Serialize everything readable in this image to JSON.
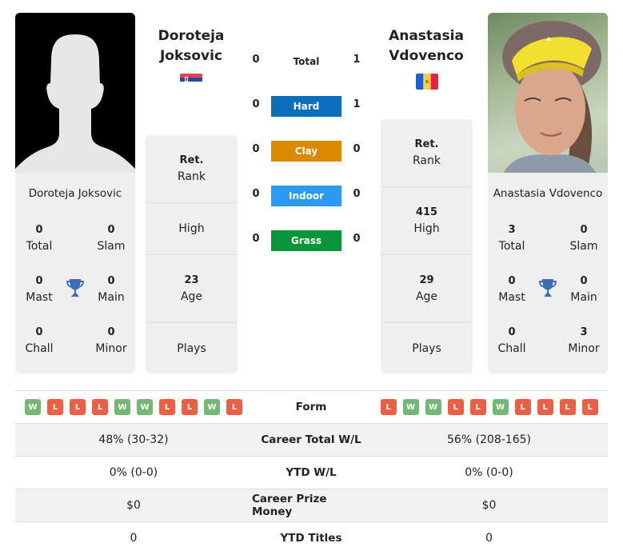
{
  "player1": {
    "name_line1": "Doroteja",
    "name_line2": "Joksovic",
    "full_name": "Doroteja Joksovic",
    "flag": "serbia-flag",
    "photo": "silhouette-placeholder",
    "titles": {
      "total": {
        "value": "0",
        "label": "Total"
      },
      "slam": {
        "value": "0",
        "label": "Slam"
      },
      "mast": {
        "value": "0",
        "label": "Mast"
      },
      "main": {
        "value": "0",
        "label": "Main"
      },
      "chall": {
        "value": "0",
        "label": "Chall"
      },
      "minor": {
        "value": "0",
        "label": "Minor"
      }
    },
    "info": {
      "rank": {
        "value": "Ret.",
        "label": "Rank"
      },
      "high": {
        "value": "",
        "label": "High"
      },
      "age": {
        "value": "23",
        "label": "Age"
      },
      "plays": {
        "value": "",
        "label": "Plays"
      }
    },
    "form": [
      "W",
      "L",
      "L",
      "L",
      "W",
      "W",
      "L",
      "L",
      "W",
      "L"
    ],
    "career_wl": "48% (30-32)",
    "ytd_wl": "0% (0-0)",
    "prize_money": "$0",
    "ytd_titles": "0"
  },
  "player2": {
    "name_line1": "Anastasia",
    "name_line2": "Vdovenco",
    "full_name": "Anastasia Vdovenco",
    "flag": "moldova-flag",
    "photo": "player-photo",
    "titles": {
      "total": {
        "value": "3",
        "label": "Total"
      },
      "slam": {
        "value": "0",
        "label": "Slam"
      },
      "mast": {
        "value": "0",
        "label": "Mast"
      },
      "main": {
        "value": "0",
        "label": "Main"
      },
      "chall": {
        "value": "0",
        "label": "Chall"
      },
      "minor": {
        "value": "3",
        "label": "Minor"
      }
    },
    "info": {
      "rank": {
        "value": "Ret.",
        "label": "Rank"
      },
      "high": {
        "value": "415",
        "label": "High"
      },
      "age": {
        "value": "29",
        "label": "Age"
      },
      "plays": {
        "value": "",
        "label": "Plays"
      }
    },
    "form": [
      "L",
      "W",
      "W",
      "L",
      "L",
      "W",
      "L",
      "L",
      "L",
      "L"
    ],
    "career_wl": "56% (208-165)",
    "ytd_wl": "0% (0-0)",
    "prize_money": "$0",
    "ytd_titles": "0"
  },
  "h2h": {
    "total": {
      "label": "Total",
      "p1": "0",
      "p2": "1"
    },
    "surfaces": [
      {
        "label": "Hard",
        "p1": "0",
        "p2": "1",
        "color": "#0a6ebd"
      },
      {
        "label": "Clay",
        "p1": "0",
        "p2": "0",
        "color": "#db8a00"
      },
      {
        "label": "Indoor",
        "p1": "0",
        "p2": "0",
        "color": "#2b9af3"
      },
      {
        "label": "Grass",
        "p1": "0",
        "p2": "0",
        "color": "#0a9638"
      }
    ]
  },
  "table": {
    "form_label": "Form",
    "career_wl_label": "Career Total W/L",
    "ytd_wl_label": "YTD W/L",
    "prize_label": "Career Prize Money",
    "ytd_titles_label": "YTD Titles"
  },
  "colors": {
    "win": "#73b873",
    "loss": "#ec5f45",
    "trophy": "#3d6fb6",
    "card_bg": "#efefef"
  }
}
